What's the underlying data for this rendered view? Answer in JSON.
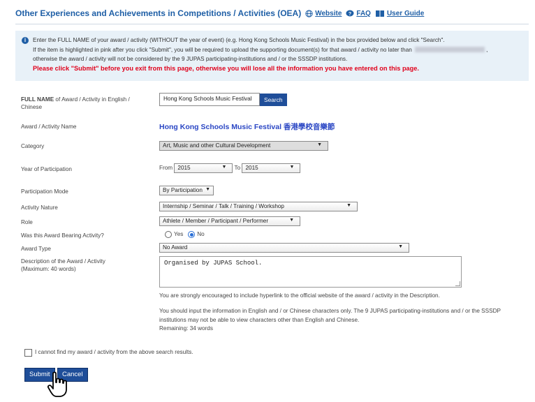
{
  "header": {
    "title": "Other Experiences and Achievements in Competitions / Activities (OEA)",
    "links": {
      "website": "Website",
      "faq": "FAQ",
      "user_guide": "User Guide"
    }
  },
  "notice": {
    "line1": "Enter the FULL NAME of your award / activity (WITHOUT the year of event) (e.g. Hong Kong Schools Music Festival) in the box provided below and click \"Search\".",
    "line2a": "If the item is highlighted in pink after you click \"Submit\", you will be required to upload the supporting document(s) for that award / activity no later than",
    "line2b": ",",
    "line3": "otherwise the award / activity will not be considered by the 9 JUPAS participating-institutions and / or the SSSDP institutions.",
    "warning": "Please click \"Submit\" before you exit from this page, otherwise you will lose all the information you have entered on this page."
  },
  "form": {
    "full_name": {
      "label": "FULL NAME of Award / Activity in English / Chinese",
      "label_bold": "FULL NAME",
      "label_rest": " of Award / Activity in English / Chinese",
      "value": "Hong Kong Schools Music Festival",
      "search_button": "Search"
    },
    "award_name": {
      "label": "Award / Activity Name",
      "value": "Hong Kong Schools Music Festival 香港學校音樂節"
    },
    "category": {
      "label": "Category",
      "value": "Art, Music and other Cultural Development"
    },
    "year": {
      "label": "Year of Participation",
      "from_label": "From",
      "from_value": "2015",
      "to_label": "To",
      "to_value": "2015"
    },
    "participation_mode": {
      "label": "Participation Mode",
      "value": "By Participation"
    },
    "activity_nature": {
      "label": "Activity Nature",
      "value": "Internship / Seminar / Talk / Training / Workshop"
    },
    "role": {
      "label": "Role",
      "value": "Athlete / Member / Participant / Performer"
    },
    "award_bearing": {
      "label": "Was this Award Bearing Activity?",
      "yes": "Yes",
      "no": "No",
      "selected": "No"
    },
    "award_type": {
      "label": "Award Type",
      "value": "No Award"
    },
    "description": {
      "label": "Description of the Award / Activity",
      "sublabel": "(Maximum: 40 words)",
      "value": "Organised by JUPAS School.",
      "hint1": "You are strongly encouraged to include hyperlink to the official website of the award / activity in the Description.",
      "hint2": "You should input the information in English and / or Chinese characters only. The 9 JUPAS participating-institutions and / or the SSSDP institutions may not be able to view characters other than English and Chinese.",
      "remaining": "Remaining:  34 words"
    },
    "cannot_find": "I cannot find my award / activity from the above search results."
  },
  "buttons": {
    "submit": "Submit",
    "cancel": "Cancel"
  },
  "colors": {
    "brand_blue": "#1f4e99",
    "title_blue": "#1f5fa6",
    "warning_red": "#e0001b",
    "notice_bg": "#e8f1f8"
  }
}
